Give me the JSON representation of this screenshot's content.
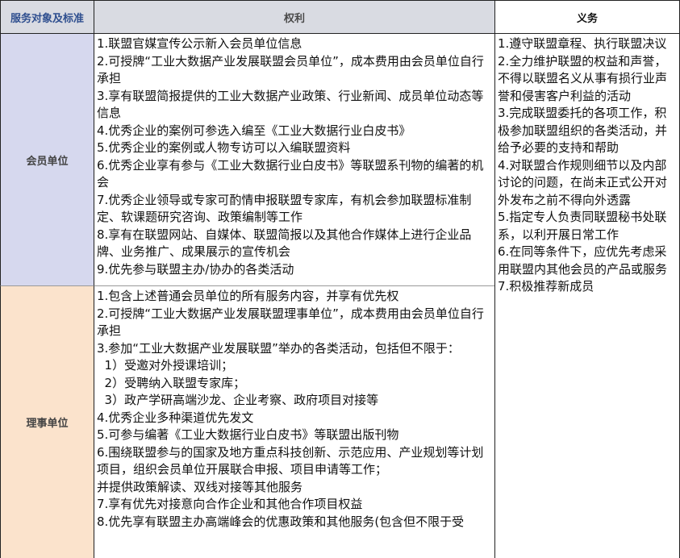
{
  "header": {
    "col1": "服务对象及标准",
    "col2": "权利",
    "col3": "义务"
  },
  "rows": [
    {
      "label": "会员单位",
      "rights": [
        "1.联盟官媒宣传公示新入会员单位信息",
        "2.可授牌“工业大数据产业发展联盟会员单位”，成本费用由会员单位自行承担",
        "3.享有联盟简报提供的工业大数据产业政策、行业新闻、成员单位动态等信息",
        "4.优秀企业的案例可参选入编至《工业大数据行业白皮书》",
        "5.优秀企业的案例或人物专访可以入编联盟资料",
        "6.优秀企业享有参与《工业大数据行业白皮书》等联盟系刊物的编著的机会",
        "7.优秀企业领导或专家可酌情申报联盟专家库，有机会参加联盟标准制定、软课题研究咨询、政策编制等工作",
        "8.享有在联盟网站、自媒体、联盟简报以及其他合作媒体上进行企业品牌、业务推广、成果展示的宣传机会",
        "9.优先参与联盟主办/协办的各类活动"
      ]
    },
    {
      "label": "理事单位",
      "rights": [
        "1.包含上述普通会员单位的所有服务内容，并享有优先权",
        "2.可授牌“工业大数据产业发展联盟理事单位”，成本费用由会员单位自行承担",
        "3.参加“工业大数据产业发展联盟”举办的各类活动，包括但不限于：",
        "  1）受邀对外授课培训；",
        "  2）受聘纳入联盟专家库；",
        "  3）政产学研高端沙龙、企业考察、政府项目对接等",
        "4.优秀企业多种渠道优先发文",
        "5.可参与编著《工业大数据行业白皮书》等联盟出版刊物",
        "6.围绕联盟参与的国家及地方重点科技创新、示范应用、产业规划等计划项目，组织会员单位开展联合申报、项目申请等工作；",
        "并提供政策解读、双线对接等其他服务",
        "7.享有优先对接意向合作企业和其他合作项目权益",
        "8.优先享有联盟主办高端峰会的优惠政策和其他服务(包含但不限于受"
      ]
    }
  ],
  "obligations": [
    "1.遵守联盟章程、执行联盟决议",
    "2.全力维护联盟的权益和声誉，不得以联盟名义从事有损行业声誉和侵害客户利益的活动",
    "3.完成联盟委托的各项工作，积极参加联盟组织的各类活动，并给予必要的支持和帮助",
    "4.对联盟合作规则细节以及内部讨论的问题，在尚未正式公开对外发布之前不得向外透露",
    "5.指定专人负责同联盟秘书处联系，以利开展日常工作",
    "6.在同等条件下，应优先考虑采用联盟内其他会员的产品或服务",
    "7.积极推荐新成员"
  ]
}
